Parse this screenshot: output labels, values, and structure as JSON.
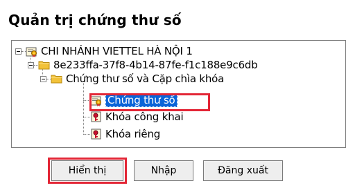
{
  "title": "Quản trị chứng thư số",
  "tree": {
    "root": {
      "label": "CHI NHÁNH VIETTEL HÀ NỘI 1",
      "icon": "certificate-icon"
    },
    "child1": {
      "label": "8e233ffa-37f8-4b14-87fe-f1c188e9c6db",
      "icon": "folder-icon"
    },
    "child2": {
      "label": "Chứng thư số và Cặp chìa khóa",
      "icon": "folder-icon"
    },
    "leaves": [
      {
        "label": "Chứng thư số",
        "icon": "certificate-icon",
        "selected": true
      },
      {
        "label": "Khóa công khai",
        "icon": "key-icon",
        "selected": false
      },
      {
        "label": "Khóa riêng",
        "icon": "key-icon",
        "selected": false
      }
    ]
  },
  "buttons": {
    "show": "Hiển thị",
    "import": "Nhập",
    "export": "Đăng xuất"
  },
  "colors": {
    "highlight": "#e32636",
    "selection": "#0a64d8",
    "folder": "#f2c23a"
  }
}
